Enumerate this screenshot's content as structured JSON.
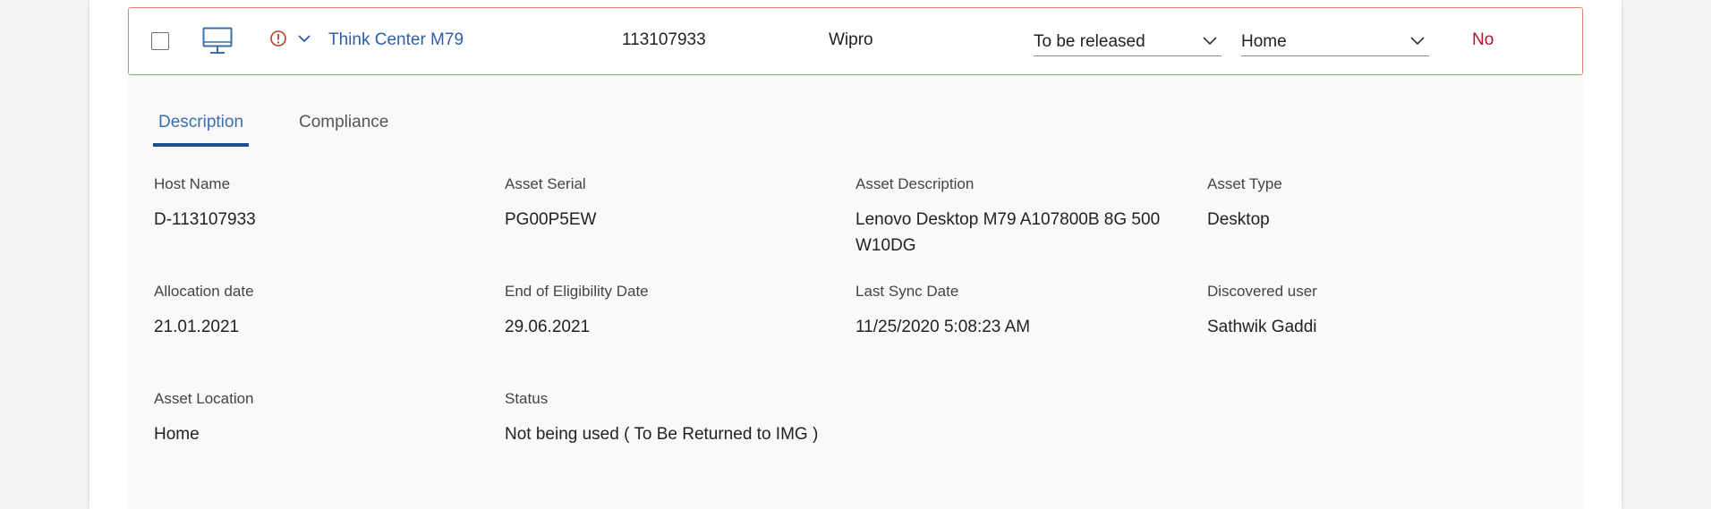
{
  "row": {
    "asset_name": "Think Center M79",
    "asset_number": "113107933",
    "vendor": "Wipro",
    "status_select": "To be released",
    "location_select": "Home",
    "flag": "No"
  },
  "tabs": [
    "Description",
    "Compliance"
  ],
  "fields": {
    "host_name": {
      "label": "Host Name",
      "value": "D-113107933"
    },
    "asset_serial": {
      "label": "Asset Serial",
      "value": "PG00P5EW"
    },
    "asset_description": {
      "label": "Asset Description",
      "value_line1": "Lenovo Desktop M79 A107800B 8G 500",
      "value_line2": "W10DG"
    },
    "asset_type": {
      "label": "Asset Type",
      "value": "Desktop"
    },
    "allocation_date": {
      "label": "Allocation date",
      "value": "21.01.2021"
    },
    "end_of_eligibility": {
      "label": "End of Eligibility Date",
      "value": "29.06.2021"
    },
    "last_sync": {
      "label": "Last Sync Date",
      "value": "11/25/2020 5:08:23 AM"
    },
    "discovered_user": {
      "label": "Discovered user",
      "value": "Sathwik Gaddi"
    },
    "asset_location": {
      "label": "Asset Location",
      "value": "Home"
    },
    "status": {
      "label": "Status",
      "value": "Not being used ( To Be Returned to IMG )"
    }
  },
  "colors": {
    "link": "#2d5fa8",
    "row_border": "#e8836f",
    "alert": "#c0392b",
    "flag": "#b0132b",
    "tab_active": "#1e4f96"
  },
  "icons": [
    "monitor-icon",
    "alert-icon",
    "chevron-down-icon"
  ]
}
